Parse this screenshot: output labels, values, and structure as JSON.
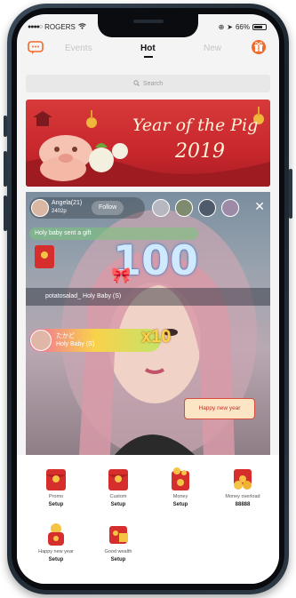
{
  "status_bar": {
    "carrier": "ROGERS",
    "battery_percent": "66%"
  },
  "nav": {
    "tabs": [
      {
        "label": "Events",
        "active": false
      },
      {
        "label": "Hot",
        "active": true
      },
      {
        "label": "New",
        "active": false
      }
    ],
    "chat_icon": "chat-bubble-icon",
    "gift_icon": "gift-icon",
    "accent_color": "#f26a2a"
  },
  "search": {
    "placeholder": "Search"
  },
  "banner": {
    "title": "Year of the Pig",
    "year": "2019"
  },
  "live": {
    "host_name": "Angela(21)",
    "host_count": "2402p",
    "follow_label": "Follow",
    "system_message": "Holy baby sent a gift",
    "combo_number": "100",
    "viewer_message": "potatosalad_  Holy Baby (S)",
    "gift_user": "たかど",
    "gift_name": "Holy Baby (S)",
    "gift_multiplier": "x10",
    "card_text": "Happy new year"
  },
  "gifts": [
    {
      "label": "Promo",
      "price": "Setup"
    },
    {
      "label": "Custom",
      "price": "Setup"
    },
    {
      "label": "Money",
      "price": "Setup"
    },
    {
      "label": "Money overload",
      "price": "88888"
    },
    {
      "label": "Happy new year",
      "price": "Setup"
    },
    {
      "label": "Good wealth",
      "price": "Setup"
    }
  ]
}
